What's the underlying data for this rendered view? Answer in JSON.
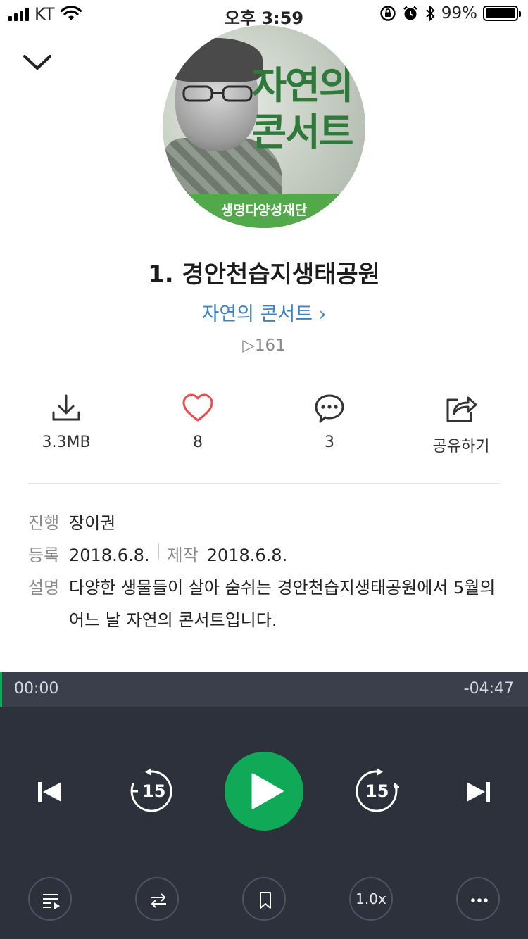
{
  "status_bar": {
    "carrier": "KT",
    "time": "오후 3:59",
    "battery": "99%"
  },
  "cover": {
    "art_title_line1": "자연의",
    "art_title_line2": "콘서트",
    "publisher_band": "생명다양성재단"
  },
  "track": {
    "title": "1. 경안천습지생태공원",
    "channel": "자연의 콘서트 ›",
    "play_count": "▷161"
  },
  "actions": {
    "download_label": "3.3MB",
    "like_count": "8",
    "comment_count": "3",
    "share_label": "공유하기"
  },
  "info": {
    "host_key": "진행",
    "host_value": "장이권",
    "registered_key": "등록",
    "registered_value": "2018.6.8.",
    "produced_key": "제작",
    "produced_value": "2018.6.8.",
    "description_key": "설명",
    "description_value": "다양한 생물들이 살아 숨쉬는 경안천습지생태공원에서 5월의 어느 날 자연의 콘서트입니다."
  },
  "player": {
    "elapsed": "00:00",
    "remaining": "-04:47",
    "progress": 0,
    "rewind_label": "15",
    "forward_label": "15",
    "speed_label": "1.0x"
  },
  "colors": {
    "accent": "#0fa957",
    "link": "#3a83c8",
    "like": "#e94e4e",
    "player_bg": "#2c313c"
  }
}
